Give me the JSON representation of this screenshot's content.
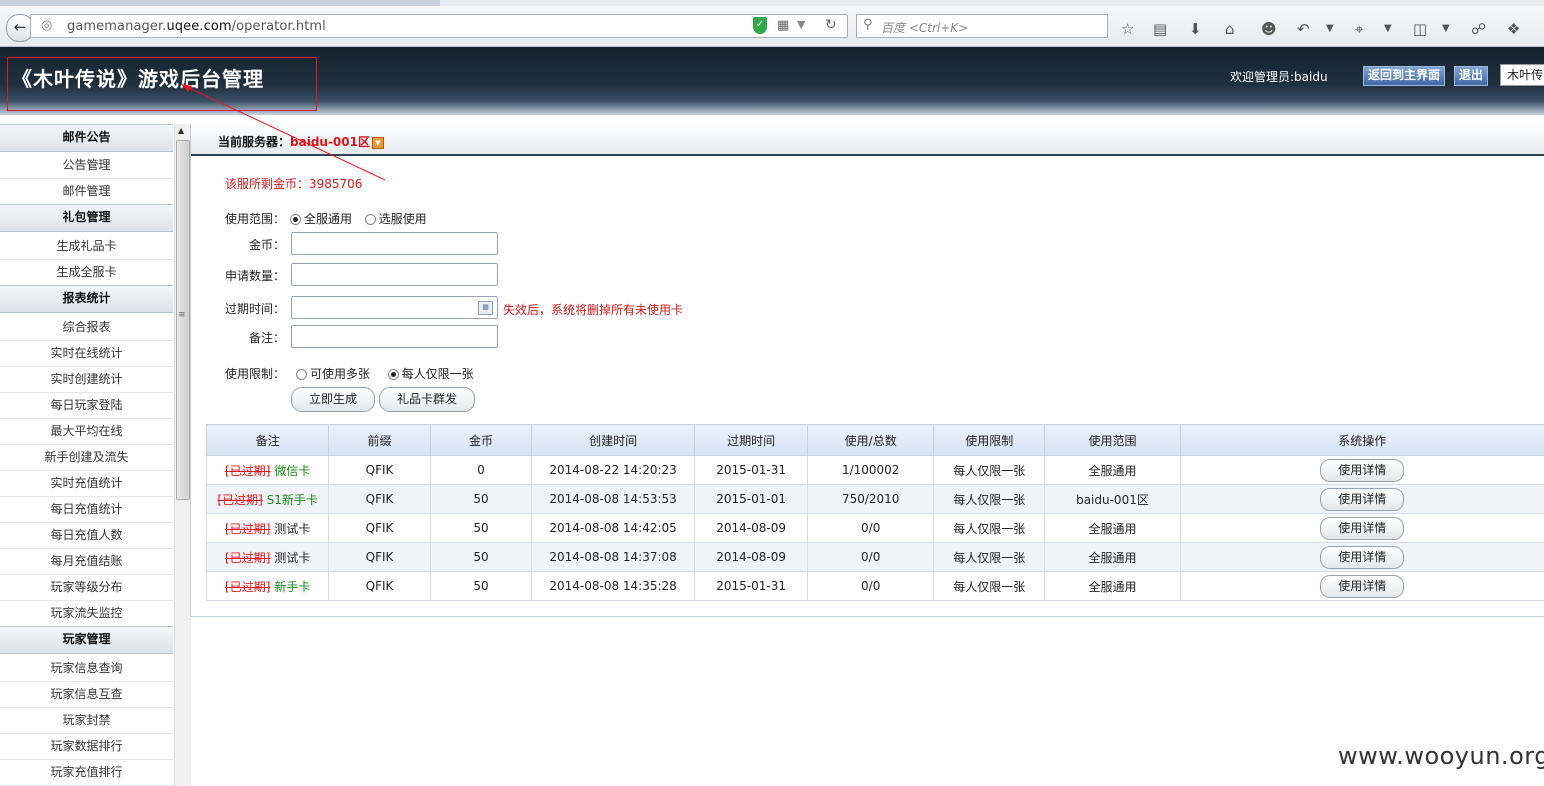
{
  "browser": {
    "url_prefix": "gamemanager.",
    "url_domain": "uqee.com",
    "url_path": "/operator.html",
    "search_placeholder": "百度 <Ctrl+K>"
  },
  "header": {
    "title": "《木叶传说》游戏后台管理",
    "welcome": "欢迎管理员:baidu",
    "back_button": "返回到主界面",
    "logout_button": "退出",
    "game_select": "木叶传"
  },
  "sidebar": {
    "groups": [
      {
        "label": "邮件公告",
        "items": [
          "公告管理",
          "邮件管理"
        ]
      },
      {
        "label": "礼包管理",
        "items": [
          "生成礼品卡",
          "生成全服卡"
        ]
      },
      {
        "label": "报表统计",
        "items": [
          "综合报表",
          "实时在线统计",
          "实时创建统计",
          "每日玩家登陆",
          "最大平均在线",
          "新手创建及流失",
          "实时充值统计",
          "每日充值统计",
          "每日充值人数",
          "每月充值结账",
          "玩家等级分布",
          "玩家流失监控"
        ]
      },
      {
        "label": "玩家管理",
        "items": [
          "玩家信息查询",
          "玩家信息互查",
          "玩家封禁",
          "玩家数据排行",
          "玩家充值排行"
        ]
      }
    ]
  },
  "server": {
    "label": "当前服务器：",
    "name": "baidu-001区"
  },
  "form": {
    "gold_left": "该服所剩金币：3985706",
    "scope_label": "使用范围：",
    "scope_all": "全服通用",
    "scope_select": "选服使用",
    "gold_label": "金币：",
    "quantity_label": "申请数量：",
    "expire_label": "过期时间：",
    "expire_hint": "失效后，系统将删掉所有未使用卡",
    "note_label": "备注：",
    "limit_label": "使用限制：",
    "limit_multi": "可使用多张",
    "limit_one": "每人仅限一张",
    "generate_button": "立即生成",
    "mass_button": "礼品卡群发",
    "gold_value": "",
    "quantity_value": "",
    "expire_value": "",
    "note_value": ""
  },
  "table": {
    "headers": [
      "备注",
      "前缀",
      "金币",
      "创建时间",
      "过期时间",
      "使用/总数",
      "使用限制",
      "使用范围",
      "系统操作"
    ],
    "rows": [
      {
        "status": "[已过期]",
        "name": "微信卡",
        "prefix": "QFIK",
        "gold": "0",
        "created": "2014-08-22 14:20:23",
        "expires": "2015-01-31",
        "usage": "1/100002",
        "limit": "每人仅限一张",
        "scope": "全服通用",
        "scope_color": "green",
        "action": "使用详情"
      },
      {
        "status": "[已过期]",
        "name": "S1新手卡",
        "prefix": "QFIK",
        "gold": "50",
        "created": "2014-08-08 14:53:53",
        "expires": "2015-01-01",
        "usage": "750/2010",
        "limit": "每人仅限一张",
        "scope": "baidu-001区",
        "scope_color": "red",
        "action": "使用详情"
      },
      {
        "status": "[已过期]",
        "name": "测试卡",
        "prefix": "QFIK",
        "gold": "50",
        "created": "2014-08-08 14:42:05",
        "expires": "2014-08-09",
        "usage": "0/0",
        "limit": "每人仅限一张",
        "scope": "全服通用",
        "scope_color": "green",
        "action": "使用详情"
      },
      {
        "status": "[已过期]",
        "name": "测试卡",
        "prefix": "QFIK",
        "gold": "50",
        "created": "2014-08-08 14:37:08",
        "expires": "2014-08-09",
        "usage": "0/0",
        "limit": "每人仅限一张",
        "scope": "全服通用",
        "scope_color": "green",
        "action": "使用详情"
      },
      {
        "status": "[已过期]",
        "name": "新手卡",
        "prefix": "QFIK",
        "gold": "50",
        "created": "2014-08-08 14:35:28",
        "expires": "2015-01-31",
        "usage": "0/0",
        "limit": "每人仅限一张",
        "scope": "全服通用",
        "scope_color": "green",
        "action": "使用详情"
      }
    ]
  },
  "watermark": "www.wooyun.org",
  "colors": {
    "accent_red": "#e01818",
    "ok_green": "#1a8a1a",
    "header_dark": "#16232f"
  }
}
